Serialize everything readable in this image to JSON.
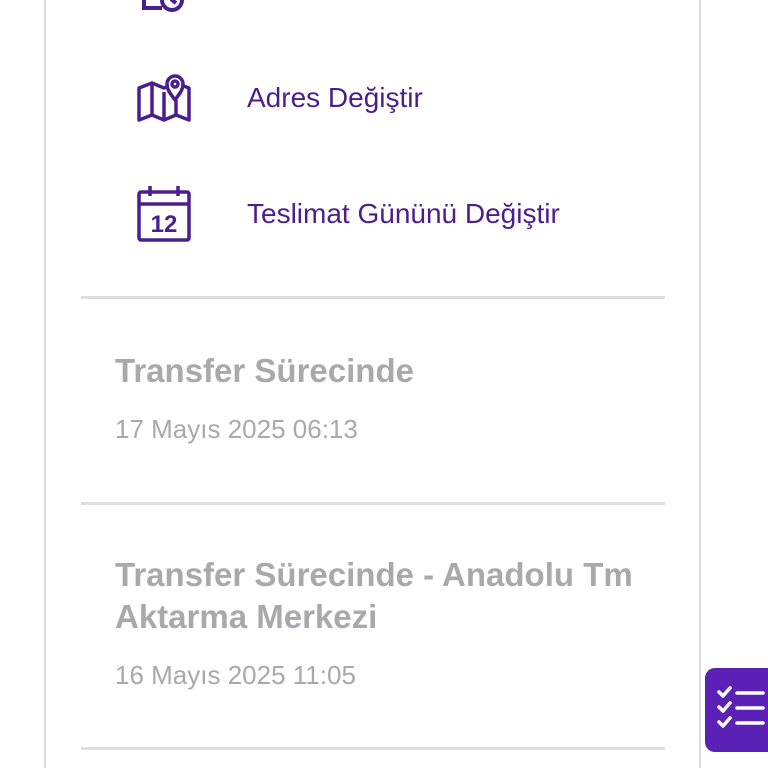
{
  "colors": {
    "accent": "#4b1e8f",
    "fab": "#5b21b6",
    "muted_text": "#a9a9ad",
    "divider": "#dedede"
  },
  "actions": [
    {
      "label": "Adres Değiştir",
      "icon": "map-pin-icon"
    },
    {
      "label": "Teslimat Gününü Değiştir",
      "icon": "calendar-icon",
      "icon_text": "12"
    }
  ],
  "events": [
    {
      "title": "Transfer Sürecinde",
      "date": "17 Mayıs 2025 06:13"
    },
    {
      "title": "Transfer Sürecinde - Anadolu Tm Aktarma Merkezi",
      "date": "16 Mayıs 2025 11:05"
    }
  ],
  "fab": {
    "icon": "checklist-icon"
  }
}
